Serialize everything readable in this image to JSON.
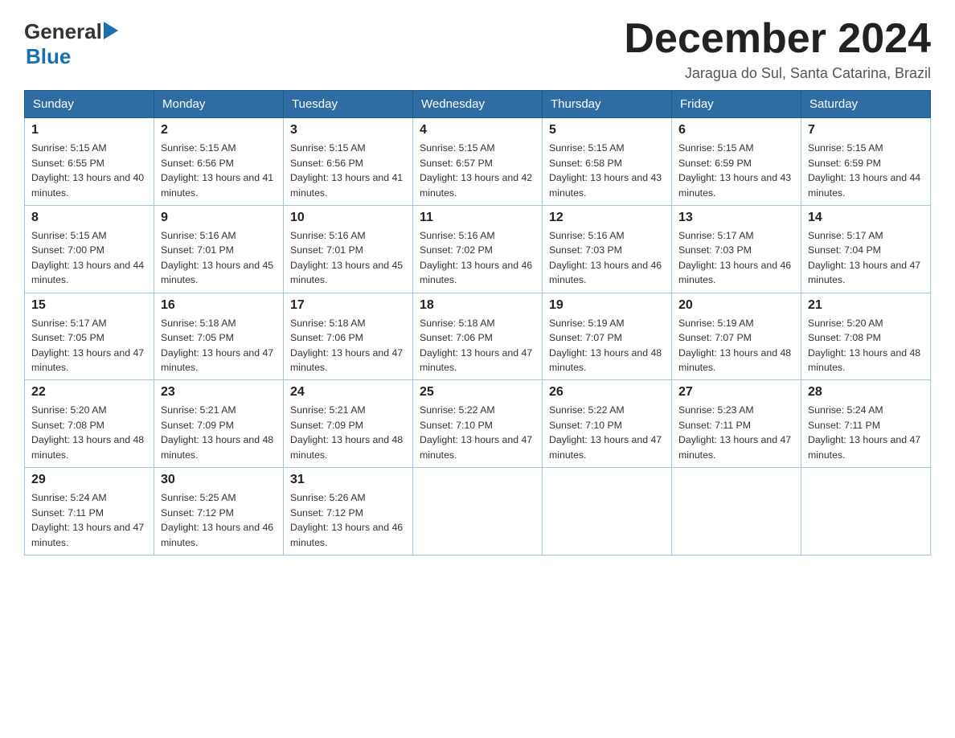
{
  "logo": {
    "general": "General",
    "blue": "Blue"
  },
  "header": {
    "month_year": "December 2024",
    "location": "Jaragua do Sul, Santa Catarina, Brazil"
  },
  "weekdays": [
    "Sunday",
    "Monday",
    "Tuesday",
    "Wednesday",
    "Thursday",
    "Friday",
    "Saturday"
  ],
  "weeks": [
    [
      {
        "day": "1",
        "sunrise": "Sunrise: 5:15 AM",
        "sunset": "Sunset: 6:55 PM",
        "daylight": "Daylight: 13 hours and 40 minutes."
      },
      {
        "day": "2",
        "sunrise": "Sunrise: 5:15 AM",
        "sunset": "Sunset: 6:56 PM",
        "daylight": "Daylight: 13 hours and 41 minutes."
      },
      {
        "day": "3",
        "sunrise": "Sunrise: 5:15 AM",
        "sunset": "Sunset: 6:56 PM",
        "daylight": "Daylight: 13 hours and 41 minutes."
      },
      {
        "day": "4",
        "sunrise": "Sunrise: 5:15 AM",
        "sunset": "Sunset: 6:57 PM",
        "daylight": "Daylight: 13 hours and 42 minutes."
      },
      {
        "day": "5",
        "sunrise": "Sunrise: 5:15 AM",
        "sunset": "Sunset: 6:58 PM",
        "daylight": "Daylight: 13 hours and 43 minutes."
      },
      {
        "day": "6",
        "sunrise": "Sunrise: 5:15 AM",
        "sunset": "Sunset: 6:59 PM",
        "daylight": "Daylight: 13 hours and 43 minutes."
      },
      {
        "day": "7",
        "sunrise": "Sunrise: 5:15 AM",
        "sunset": "Sunset: 6:59 PM",
        "daylight": "Daylight: 13 hours and 44 minutes."
      }
    ],
    [
      {
        "day": "8",
        "sunrise": "Sunrise: 5:15 AM",
        "sunset": "Sunset: 7:00 PM",
        "daylight": "Daylight: 13 hours and 44 minutes."
      },
      {
        "day": "9",
        "sunrise": "Sunrise: 5:16 AM",
        "sunset": "Sunset: 7:01 PM",
        "daylight": "Daylight: 13 hours and 45 minutes."
      },
      {
        "day": "10",
        "sunrise": "Sunrise: 5:16 AM",
        "sunset": "Sunset: 7:01 PM",
        "daylight": "Daylight: 13 hours and 45 minutes."
      },
      {
        "day": "11",
        "sunrise": "Sunrise: 5:16 AM",
        "sunset": "Sunset: 7:02 PM",
        "daylight": "Daylight: 13 hours and 46 minutes."
      },
      {
        "day": "12",
        "sunrise": "Sunrise: 5:16 AM",
        "sunset": "Sunset: 7:03 PM",
        "daylight": "Daylight: 13 hours and 46 minutes."
      },
      {
        "day": "13",
        "sunrise": "Sunrise: 5:17 AM",
        "sunset": "Sunset: 7:03 PM",
        "daylight": "Daylight: 13 hours and 46 minutes."
      },
      {
        "day": "14",
        "sunrise": "Sunrise: 5:17 AM",
        "sunset": "Sunset: 7:04 PM",
        "daylight": "Daylight: 13 hours and 47 minutes."
      }
    ],
    [
      {
        "day": "15",
        "sunrise": "Sunrise: 5:17 AM",
        "sunset": "Sunset: 7:05 PM",
        "daylight": "Daylight: 13 hours and 47 minutes."
      },
      {
        "day": "16",
        "sunrise": "Sunrise: 5:18 AM",
        "sunset": "Sunset: 7:05 PM",
        "daylight": "Daylight: 13 hours and 47 minutes."
      },
      {
        "day": "17",
        "sunrise": "Sunrise: 5:18 AM",
        "sunset": "Sunset: 7:06 PM",
        "daylight": "Daylight: 13 hours and 47 minutes."
      },
      {
        "day": "18",
        "sunrise": "Sunrise: 5:18 AM",
        "sunset": "Sunset: 7:06 PM",
        "daylight": "Daylight: 13 hours and 47 minutes."
      },
      {
        "day": "19",
        "sunrise": "Sunrise: 5:19 AM",
        "sunset": "Sunset: 7:07 PM",
        "daylight": "Daylight: 13 hours and 48 minutes."
      },
      {
        "day": "20",
        "sunrise": "Sunrise: 5:19 AM",
        "sunset": "Sunset: 7:07 PM",
        "daylight": "Daylight: 13 hours and 48 minutes."
      },
      {
        "day": "21",
        "sunrise": "Sunrise: 5:20 AM",
        "sunset": "Sunset: 7:08 PM",
        "daylight": "Daylight: 13 hours and 48 minutes."
      }
    ],
    [
      {
        "day": "22",
        "sunrise": "Sunrise: 5:20 AM",
        "sunset": "Sunset: 7:08 PM",
        "daylight": "Daylight: 13 hours and 48 minutes."
      },
      {
        "day": "23",
        "sunrise": "Sunrise: 5:21 AM",
        "sunset": "Sunset: 7:09 PM",
        "daylight": "Daylight: 13 hours and 48 minutes."
      },
      {
        "day": "24",
        "sunrise": "Sunrise: 5:21 AM",
        "sunset": "Sunset: 7:09 PM",
        "daylight": "Daylight: 13 hours and 48 minutes."
      },
      {
        "day": "25",
        "sunrise": "Sunrise: 5:22 AM",
        "sunset": "Sunset: 7:10 PM",
        "daylight": "Daylight: 13 hours and 47 minutes."
      },
      {
        "day": "26",
        "sunrise": "Sunrise: 5:22 AM",
        "sunset": "Sunset: 7:10 PM",
        "daylight": "Daylight: 13 hours and 47 minutes."
      },
      {
        "day": "27",
        "sunrise": "Sunrise: 5:23 AM",
        "sunset": "Sunset: 7:11 PM",
        "daylight": "Daylight: 13 hours and 47 minutes."
      },
      {
        "day": "28",
        "sunrise": "Sunrise: 5:24 AM",
        "sunset": "Sunset: 7:11 PM",
        "daylight": "Daylight: 13 hours and 47 minutes."
      }
    ],
    [
      {
        "day": "29",
        "sunrise": "Sunrise: 5:24 AM",
        "sunset": "Sunset: 7:11 PM",
        "daylight": "Daylight: 13 hours and 47 minutes."
      },
      {
        "day": "30",
        "sunrise": "Sunrise: 5:25 AM",
        "sunset": "Sunset: 7:12 PM",
        "daylight": "Daylight: 13 hours and 46 minutes."
      },
      {
        "day": "31",
        "sunrise": "Sunrise: 5:26 AM",
        "sunset": "Sunset: 7:12 PM",
        "daylight": "Daylight: 13 hours and 46 minutes."
      },
      null,
      null,
      null,
      null
    ]
  ]
}
